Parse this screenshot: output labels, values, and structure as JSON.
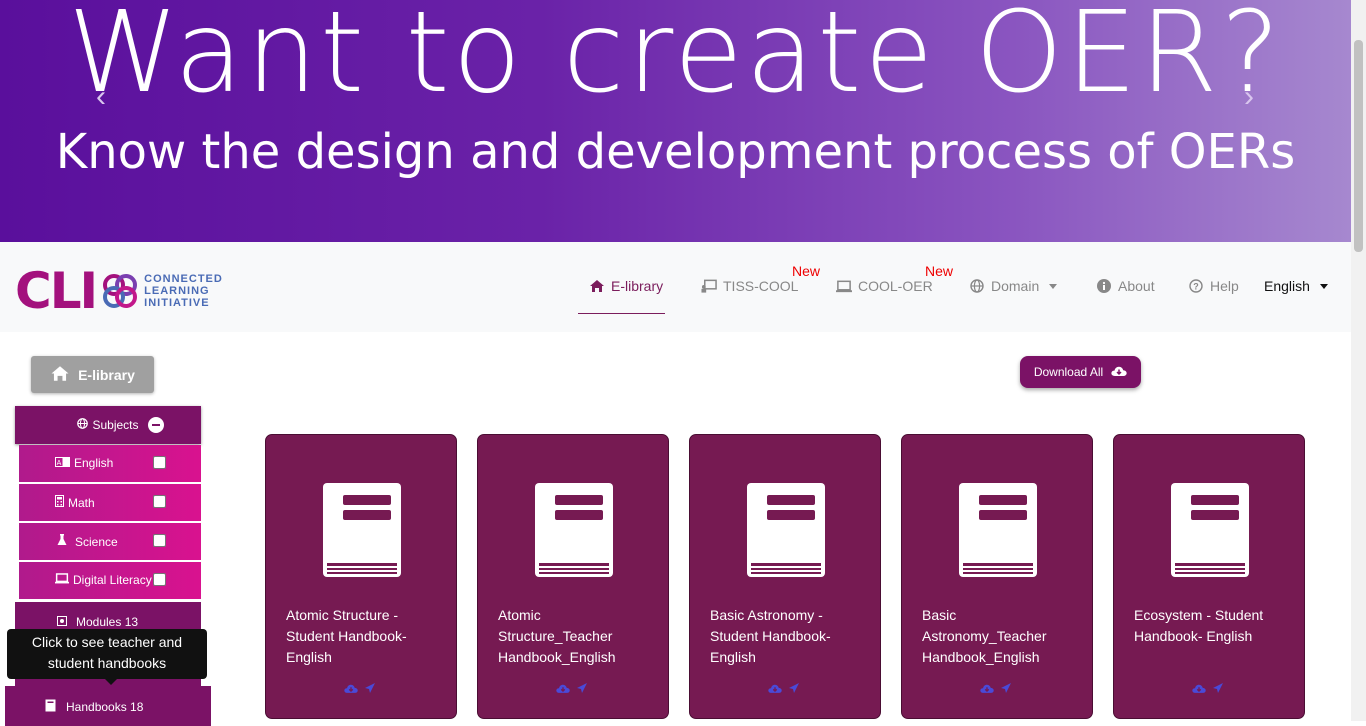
{
  "banner": {
    "headline": "Want to create OER?",
    "subheadline": "Know the design and development process of OERs",
    "prev_glyph": "‹",
    "next_glyph": "›"
  },
  "logo": {
    "mark": "CLI",
    "line1": "CONNECTED",
    "line2": "LEARNING",
    "line3": "INITIATIVE"
  },
  "nav": {
    "elibrary": "E-library",
    "tiss": "TISS-COOL",
    "cool": "COOL-OER",
    "domain": "Domain",
    "about": "About",
    "help": "Help",
    "language": "English",
    "new_badge": "New"
  },
  "sidebar": {
    "elibrary_button": "E-library",
    "subjects": "Subjects",
    "items": [
      {
        "label": "English",
        "icon": "language-icon"
      },
      {
        "label": "Math",
        "icon": "calculator-icon"
      },
      {
        "label": "Science",
        "icon": "flask-icon"
      },
      {
        "label": "Digital Literacy",
        "icon": "laptop-icon"
      }
    ],
    "modules": "Modules 13",
    "handbooks": "Handbooks 18",
    "tooltip_line1": "Click to see teacher and",
    "tooltip_line2": "student handbooks"
  },
  "download_all": "Download All",
  "cards": [
    {
      "title": "Atomic Structure - Student Handbook- English"
    },
    {
      "title": "Atomic Structure_Teacher Handbook_English"
    },
    {
      "title": "Basic Astronomy - Student Handbook- English"
    },
    {
      "title": "Basic Astronomy_Teacher Handbook_English"
    },
    {
      "title": "Ecosystem - Student Handbook- English"
    }
  ],
  "colors": {
    "brand": "#7b1266",
    "card": "#761a52",
    "subject_gradient": "#d9128f",
    "new_badge": "#ee0000"
  }
}
